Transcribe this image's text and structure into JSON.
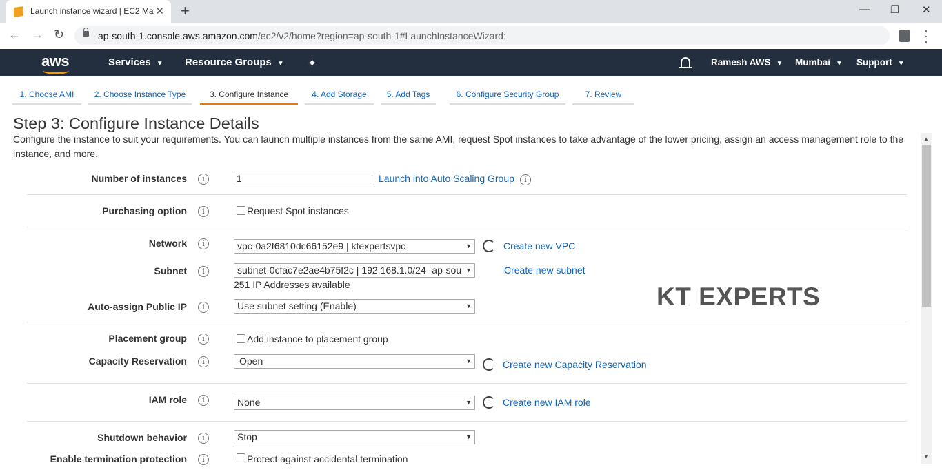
{
  "browser": {
    "tab_title": "Launch instance wizard | EC2 Ma",
    "url_host": "ap-south-1.console.aws.amazon.com",
    "url_path": "/ec2/v2/home?region=ap-south-1#LaunchInstanceWizard:"
  },
  "aws_header": {
    "logo": "aws",
    "services": "Services",
    "resource_groups": "Resource Groups",
    "account": "Ramesh AWS",
    "region": "Mumbai",
    "support": "Support"
  },
  "steps": [
    "1. Choose AMI",
    "2. Choose Instance Type",
    "3. Configure Instance",
    "4. Add Storage",
    "5. Add Tags",
    "6. Configure Security Group",
    "7. Review"
  ],
  "active_step": 3,
  "page": {
    "title": "Step 3: Configure Instance Details",
    "description": "Configure the instance to suit your requirements. You can launch multiple instances from the same AMI, request Spot instances to take advantage of the lower pricing, assign an access management role to the instance, and more."
  },
  "form": {
    "number_of_instances": {
      "label": "Number of instances",
      "value": "1",
      "link": "Launch into Auto Scaling Group"
    },
    "purchasing_option": {
      "label": "Purchasing option",
      "checkbox": "Request Spot instances"
    },
    "network": {
      "label": "Network",
      "value": "vpc-0a2f6810dc66152e9 | ktexpertsvpc",
      "link": "Create new VPC"
    },
    "subnet": {
      "label": "Subnet",
      "value": "subnet-0cfac7e2ae4b75f2c | 192.168.1.0/24 -ap-sou",
      "note": "251 IP Addresses available",
      "link": "Create new subnet"
    },
    "auto_assign_ip": {
      "label": "Auto-assign Public IP",
      "value": "Use subnet setting (Enable)"
    },
    "placement_group": {
      "label": "Placement group",
      "checkbox": "Add instance to placement group"
    },
    "capacity_reservation": {
      "label": "Capacity Reservation",
      "value": "Open",
      "link": "Create new Capacity Reservation"
    },
    "iam_role": {
      "label": "IAM role",
      "value": "None",
      "link": "Create new IAM role"
    },
    "shutdown_behavior": {
      "label": "Shutdown behavior",
      "value": "Stop"
    },
    "termination_protection": {
      "label": "Enable termination protection",
      "checkbox": "Protect against accidental termination"
    }
  },
  "watermark": "KT EXPERTS",
  "icons": {
    "info": "i",
    "caret": "▾",
    "select_arrow": "▼"
  }
}
